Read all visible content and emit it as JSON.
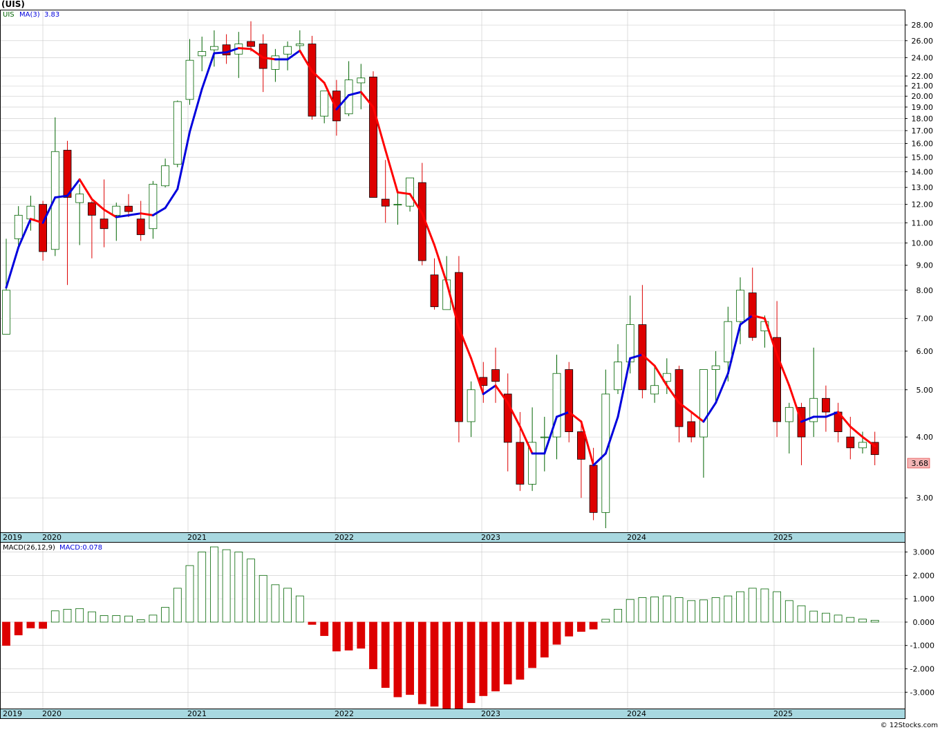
{
  "title": "(UIS)",
  "price_legend": {
    "symbol": "UIS",
    "ma_label": "MA(3)",
    "ma_value": "3.83"
  },
  "macd_legend": {
    "label": "MACD(26,12,9)",
    "value_label": "MACD:0.078"
  },
  "last_price_label": "3.68",
  "footer": "© 12Stocks.com",
  "colors": {
    "up": "#006400",
    "down": "#dd0000",
    "ma_up": "#0000dd",
    "ma_down": "#ff0000",
    "axis_band": "#a8d8e0",
    "grid": "#c8c8c8"
  },
  "chart_data": [
    {
      "type": "candlestick",
      "title": "",
      "y_scale": "log",
      "ylim": [
        2.55,
        30.0
      ],
      "y_ticks": [
        "28.00",
        "26.00",
        "24.00",
        "22.00",
        "21.00",
        "20.00",
        "19.00",
        "18.00",
        "17.00",
        "16.00",
        "15.00",
        "14.00",
        "13.00",
        "12.00",
        "11.00",
        "10.00",
        "9.00",
        "8.00",
        "7.00",
        "6.00",
        "5.00",
        "4.00",
        "3.00"
      ],
      "x_labels": [
        "2019",
        "2020",
        "2021",
        "2022",
        "2023",
        "2024",
        "2025"
      ],
      "interval": "month",
      "start": "2019-12",
      "ohlc": [
        [
          6.5,
          10.2,
          6.5,
          8.0
        ],
        [
          10.2,
          11.9,
          9.8,
          11.4
        ],
        [
          11.2,
          12.5,
          10.6,
          11.9
        ],
        [
          12.0,
          12.2,
          9.2,
          9.6
        ],
        [
          9.7,
          18.1,
          9.4,
          15.4
        ],
        [
          15.5,
          16.2,
          8.2,
          12.4
        ],
        [
          12.1,
          13.2,
          9.9,
          12.6
        ],
        [
          12.1,
          12.2,
          9.3,
          11.4
        ],
        [
          11.2,
          13.5,
          9.8,
          10.7
        ],
        [
          11.4,
          12.1,
          10.1,
          11.9
        ],
        [
          11.9,
          12.6,
          11.3,
          11.6
        ],
        [
          11.2,
          12.2,
          10.1,
          10.4
        ],
        [
          10.7,
          13.4,
          10.2,
          13.2
        ],
        [
          13.1,
          14.9,
          13.0,
          14.4
        ],
        [
          14.5,
          19.6,
          14.3,
          19.5
        ],
        [
          19.7,
          26.2,
          19.2,
          23.7
        ],
        [
          24.2,
          26.5,
          22.5,
          24.7
        ],
        [
          24.9,
          27.3,
          23.0,
          25.3
        ],
        [
          25.5,
          26.8,
          23.3,
          24.3
        ],
        [
          24.4,
          27.1,
          21.8,
          25.6
        ],
        [
          25.9,
          28.5,
          24.7,
          25.3
        ],
        [
          25.6,
          26.8,
          20.4,
          22.8
        ],
        [
          22.7,
          25.0,
          21.4,
          24.2
        ],
        [
          24.4,
          25.9,
          22.6,
          25.3
        ],
        [
          25.4,
          27.3,
          24.7,
          25.6
        ],
        [
          25.6,
          26.6,
          17.9,
          18.2
        ],
        [
          18.2,
          20.5,
          17.6,
          20.5
        ],
        [
          20.5,
          21.6,
          16.6,
          17.8
        ],
        [
          18.4,
          23.6,
          18.2,
          21.6
        ],
        [
          21.3,
          23.3,
          18.8,
          21.8
        ],
        [
          21.9,
          22.5,
          12.8,
          12.4
        ],
        [
          12.3,
          14.8,
          11.0,
          11.9
        ],
        [
          12.0,
          12.8,
          10.9,
          12.0
        ],
        [
          11.9,
          13.5,
          11.6,
          13.6
        ],
        [
          13.3,
          14.6,
          9.0,
          9.2
        ],
        [
          8.6,
          9.3,
          7.3,
          7.4
        ],
        [
          7.3,
          9.4,
          7.6,
          8.4
        ],
        [
          8.7,
          9.4,
          3.9,
          4.3
        ],
        [
          4.3,
          5.2,
          4.0,
          5.0
        ],
        [
          5.3,
          5.7,
          4.7,
          5.1
        ],
        [
          5.5,
          6.1,
          4.7,
          5.2
        ],
        [
          4.9,
          5.4,
          3.4,
          3.9
        ],
        [
          3.9,
          4.5,
          3.1,
          3.2
        ],
        [
          3.2,
          4.6,
          3.1,
          3.9
        ],
        [
          4.0,
          4.4,
          3.4,
          4.0
        ],
        [
          4.0,
          5.9,
          3.6,
          5.4
        ],
        [
          5.5,
          5.7,
          3.9,
          4.1
        ],
        [
          4.1,
          4.3,
          3.0,
          3.6
        ],
        [
          3.5,
          3.8,
          2.7,
          2.8
        ],
        [
          2.8,
          5.5,
          2.6,
          4.9
        ],
        [
          5.0,
          6.2,
          4.9,
          5.7
        ],
        [
          5.7,
          7.8,
          5.4,
          6.8
        ],
        [
          6.8,
          8.2,
          4.8,
          5.0
        ],
        [
          4.9,
          5.6,
          4.7,
          5.1
        ],
        [
          5.2,
          5.8,
          4.9,
          5.4
        ],
        [
          5.5,
          5.6,
          3.9,
          4.2
        ],
        [
          4.3,
          4.5,
          3.9,
          4.0
        ],
        [
          4.0,
          4.9,
          3.3,
          5.5
        ],
        [
          5.5,
          6.0,
          4.7,
          5.6
        ],
        [
          5.7,
          7.4,
          5.2,
          6.9
        ],
        [
          6.9,
          8.5,
          6.2,
          8.0
        ],
        [
          7.9,
          8.9,
          6.3,
          6.4
        ],
        [
          6.6,
          7.1,
          6.1,
          6.9
        ],
        [
          6.4,
          7.6,
          4.0,
          4.3
        ],
        [
          4.3,
          4.7,
          3.7,
          4.6
        ],
        [
          4.6,
          4.7,
          3.5,
          4.0
        ],
        [
          4.3,
          6.1,
          4.0,
          4.8
        ],
        [
          4.8,
          5.1,
          4.1,
          4.5
        ],
        [
          4.5,
          4.7,
          3.9,
          4.1
        ],
        [
          4.0,
          4.4,
          3.6,
          3.8
        ],
        [
          3.8,
          4.1,
          3.7,
          3.9
        ],
        [
          3.9,
          4.1,
          3.5,
          3.68
        ]
      ],
      "ma": [
        8.1,
        9.8,
        11.2,
        11.0,
        12.4,
        12.5,
        13.5,
        12.3,
        11.7,
        11.3,
        11.4,
        11.5,
        11.4,
        11.8,
        12.9,
        16.9,
        20.7,
        24.5,
        24.6,
        25.1,
        25.0,
        24.0,
        23.8,
        23.8,
        24.8,
        22.5,
        21.3,
        18.8,
        20.1,
        20.4,
        19.0,
        15.5,
        12.7,
        12.6,
        11.5,
        9.9,
        8.3,
        6.7,
        5.8,
        4.9,
        5.1,
        4.7,
        4.2,
        3.7,
        3.7,
        4.4,
        4.5,
        4.3,
        3.5,
        3.7,
        4.4,
        5.8,
        5.9,
        5.6,
        5.1,
        4.7,
        4.5,
        4.3,
        4.7,
        5.4,
        6.8,
        7.1,
        7.0,
        5.9,
        5.1,
        4.3,
        4.4,
        4.4,
        4.5,
        4.2,
        4.0,
        3.83
      ],
      "ma_period": 3,
      "last": 3.68
    },
    {
      "type": "bar",
      "title": "",
      "ylim": [
        -3.7,
        3.4
      ],
      "y_ticks": [
        "3.000",
        "2.000",
        "1.000",
        "0.000",
        "-1.000",
        "-2.000",
        "-3.000"
      ],
      "x_labels": [
        "2019",
        "2020",
        "2021",
        "2022",
        "2023",
        "2024",
        "2025"
      ],
      "values": [
        -1.0,
        -0.55,
        -0.25,
        -0.27,
        0.48,
        0.55,
        0.58,
        0.44,
        0.28,
        0.28,
        0.26,
        0.1,
        0.3,
        0.63,
        1.45,
        2.42,
        3.0,
        3.22,
        3.1,
        3.0,
        2.7,
        2.0,
        1.6,
        1.45,
        1.12,
        -0.1,
        -0.58,
        -1.24,
        -1.2,
        -1.12,
        -2.0,
        -2.8,
        -3.2,
        -3.1,
        -3.5,
        -3.6,
        -3.7,
        -3.7,
        -3.45,
        -3.15,
        -2.95,
        -2.65,
        -2.45,
        -1.95,
        -1.5,
        -0.95,
        -0.6,
        -0.4,
        -0.3,
        0.12,
        0.55,
        0.97,
        1.05,
        1.08,
        1.12,
        1.05,
        0.92,
        0.95,
        1.05,
        1.12,
        1.3,
        1.45,
        1.42,
        1.3,
        0.92,
        0.7,
        0.47,
        0.38,
        0.3,
        0.2,
        0.13,
        0.078
      ],
      "last": 0.078
    }
  ]
}
